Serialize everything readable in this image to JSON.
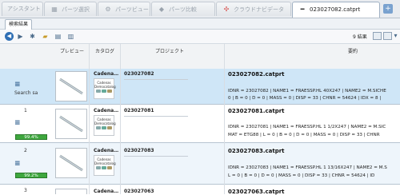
{
  "tabs": [
    {
      "label": "アシスタント",
      "icon": ""
    },
    {
      "label": "パーツ選択",
      "icon": "▦"
    },
    {
      "label": "パーツビュー",
      "icon": "⚙"
    },
    {
      "label": "パーツ比較",
      "icon": "◆"
    },
    {
      "label": "クラウドナビデータ",
      "icon": "✣"
    },
    {
      "label": "023027082.catprt",
      "icon": "━"
    }
  ],
  "subtab": "検索結果",
  "toolbar": {
    "count": "9 結果"
  },
  "columns": {
    "preview": "プレビュー",
    "catalog": "カタログ",
    "project": "プロジェクト",
    "summary": "要約"
  },
  "rows": [
    {
      "num": "",
      "label": "Search sa",
      "score": "",
      "catalog": "Cadena…",
      "catalog_box": "Cadenas Democatalog",
      "project": "023027082",
      "filename": "023027082.catprt",
      "line1": "IDNR = 23027082 | NAME1 = FRAESSP.HL 40X247 | NAME2 = M.SICHE",
      "line2": "0 | B = 0 | D = 0 | MASS = 0 | DISP = 33 | CHNR = 54624 | IDX = 8 |"
    },
    {
      "num": "1",
      "label": "",
      "score": "99.4%",
      "catalog": "Cadena…",
      "catalog_box": "Cadenas Democatalog",
      "project": "023027081",
      "filename": "023027081.catprt",
      "line1": "IDNR = 23027081 | NAME1 = FRAESSP.HL 1 1/2X247 | NAME2 = M.SIC",
      "line2": "MAT = ETG88 | L = 0 | B = 0 | D = 0 | MASS = 0 | DISP = 33 | CHNR"
    },
    {
      "num": "2",
      "label": "",
      "score": "99.2%",
      "catalog": "Cadena…",
      "catalog_box": "Cadenas Democatalog",
      "project": "023027083",
      "filename": "023027083.catprt",
      "line1": "IDNR = 23027083 | NAME1 = FRAESSP.HL 1 13/16X247 | NAME2 = M.S",
      "line2": "L = 0 | B = 0 | D = 0 | MASS = 0 | DISP = 33 | CHNR = 54624 | ID"
    },
    {
      "num": "3",
      "label": "",
      "score": "",
      "catalog": "Cadena…",
      "catalog_box": "",
      "project": "023027063",
      "filename": "023027063.catprt",
      "line1": "",
      "line2": ""
    }
  ]
}
